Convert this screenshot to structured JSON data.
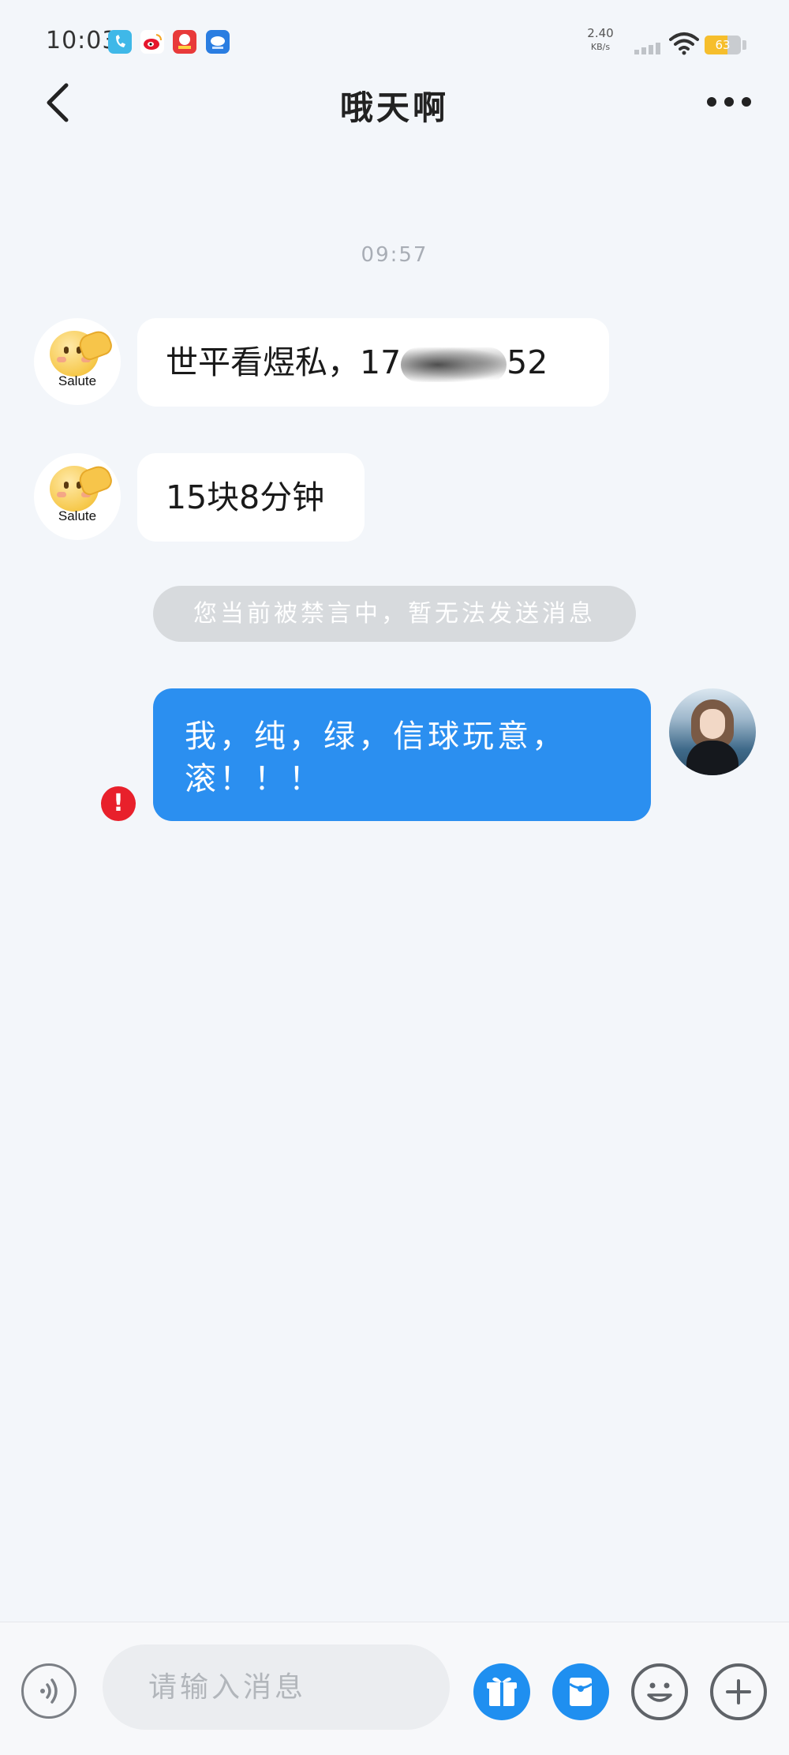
{
  "status_bar": {
    "time": "10:03",
    "net_speed_value": "2.40",
    "net_speed_unit": "KB/s",
    "battery_level": "63",
    "app_icons": [
      "phone-icon",
      "weibo-icon",
      "app-red-icon",
      "app-blue-icon"
    ]
  },
  "nav": {
    "title": "哦天啊"
  },
  "chat": {
    "timestamp": "09:57",
    "incoming": [
      {
        "avatar_caption": "Salute",
        "text_prefix": "世平看煜私，17",
        "text_suffix": "52"
      },
      {
        "avatar_caption": "Salute",
        "text": "15块8分钟"
      }
    ],
    "system_notice": "您当前被禁言中，暂无法发送消息",
    "outgoing": {
      "line1": "我，纯，绿，信球玩意，",
      "line2": "滚！！！",
      "error_symbol": "!"
    }
  },
  "input_bar": {
    "placeholder": "请输入消息"
  },
  "colors": {
    "accent_blue": "#2b8ff0",
    "background": "#f3f6fa",
    "error_red": "#e8202b",
    "battery_yellow": "#f6be2c"
  }
}
